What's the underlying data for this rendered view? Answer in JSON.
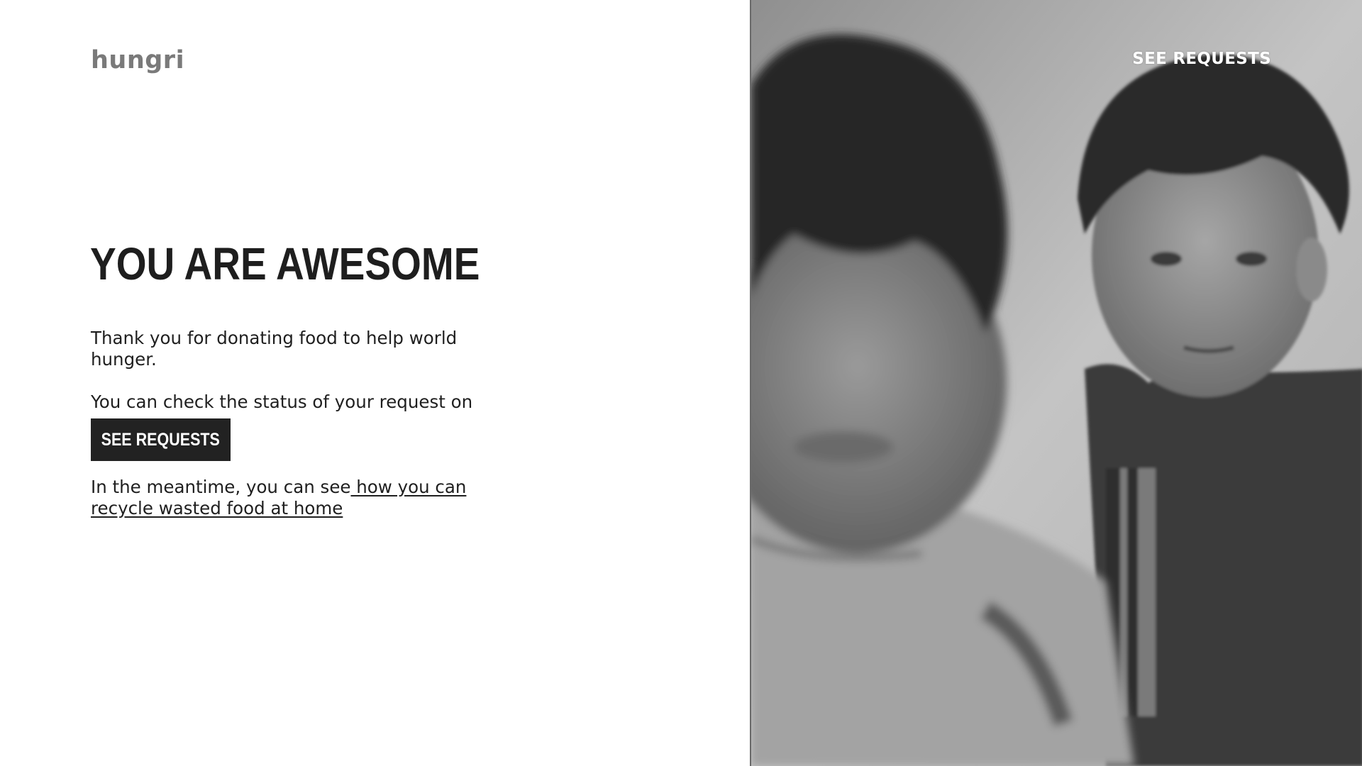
{
  "brand": {
    "name": "hungri"
  },
  "nav": {
    "requests_link": "SEE REQUESTS"
  },
  "content": {
    "headline": "YOU ARE AWESOME",
    "thanks_text": "Thank you for donating food to help world hunger.",
    "status_text": "You can check the status of your request on",
    "see_requests_button": "SEE REQUESTS",
    "meantime_text": "In the meantime, you can see",
    "recycle_link": " how you can recycle wasted food at home"
  },
  "colors": {
    "background": "#ffffff",
    "logo": "#7a7a7a",
    "text": "#1f1f1f",
    "button_bg": "#222222",
    "button_text": "#ffffff",
    "nav_link": "#ffffff"
  },
  "image": {
    "subject": "black-and-white-photo-two-children-icon"
  }
}
